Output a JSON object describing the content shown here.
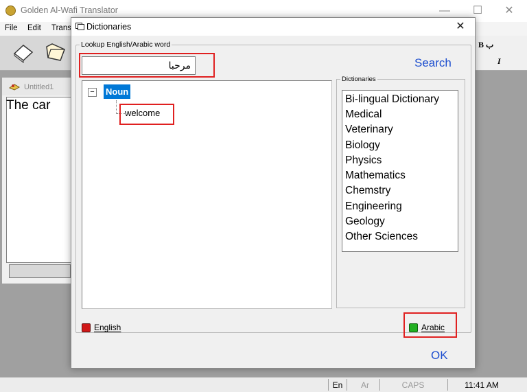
{
  "main_window": {
    "title": "Golden Al-Wafi Translator",
    "controls": {
      "minimize": "—",
      "maximize": "☐",
      "close": "✕"
    },
    "menu": [
      "File",
      "Edit",
      "Trans"
    ],
    "right_panel": {
      "label1": "B ب",
      "label2": "I"
    },
    "document": {
      "title": "Untitled1",
      "text": "The car"
    }
  },
  "status_bar": {
    "lang_en": "En",
    "lang_ar": "Ar",
    "caps": "CAPS",
    "time": "11:41 AM"
  },
  "dialog": {
    "title": "Dictionaries",
    "close": "✕",
    "lookup_legend": "Lookup English/Arabic word",
    "search_value": "مرحبا",
    "search_button": "Search",
    "tree": {
      "minus": "−",
      "node": "Noun",
      "leaf": "welcome"
    },
    "dictionaries_legend": "Dictionaries",
    "dictionaries": [
      "Bi-lingual Dictionary",
      "Medical",
      "Veterinary",
      "Biology",
      "Physics",
      "Mathematics",
      "Chemstry",
      "Engineering",
      "Geology",
      "Other Sciences"
    ],
    "option_english": "English",
    "option_arabic": "Arabic",
    "ok_button": "OK",
    "colors": {
      "english_dot": "#d01818",
      "arabic_dot": "#22b022",
      "link_blue": "#1e4fcf",
      "highlight": "#e02020"
    }
  }
}
